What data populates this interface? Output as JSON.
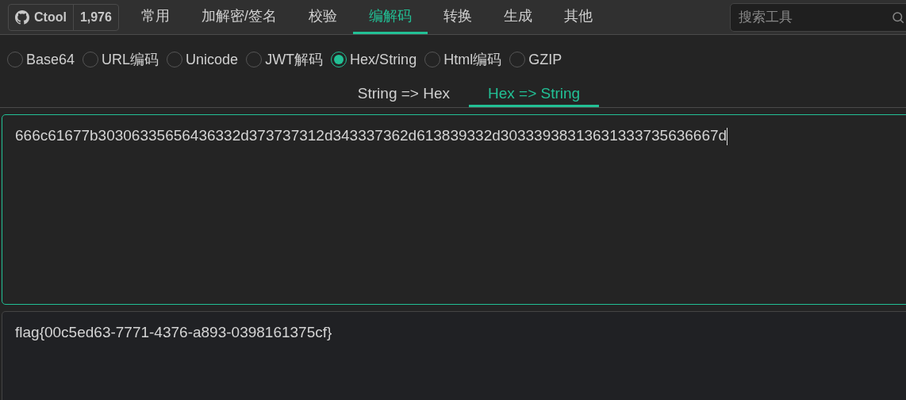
{
  "header": {
    "repo": {
      "name": "Ctool",
      "stars_count": "1,976"
    },
    "tabs": [
      {
        "label": "常用",
        "selected": false
      },
      {
        "label": "加解密/签名",
        "selected": false
      },
      {
        "label": "校验",
        "selected": false
      },
      {
        "label": "编解码",
        "selected": true
      },
      {
        "label": "转换",
        "selected": false
      },
      {
        "label": "生成",
        "selected": false
      },
      {
        "label": "其他",
        "selected": false
      }
    ],
    "search": {
      "placeholder": "搜索工具"
    }
  },
  "tools": [
    {
      "label": "Base64",
      "selected": false
    },
    {
      "label": "URL编码",
      "selected": false
    },
    {
      "label": "Unicode",
      "selected": false
    },
    {
      "label": "JWT解码",
      "selected": false
    },
    {
      "label": "Hex/String",
      "selected": true
    },
    {
      "label": "Html编码",
      "selected": false
    },
    {
      "label": "GZIP",
      "selected": false
    }
  ],
  "modes": [
    {
      "label": "String => Hex",
      "selected": false
    },
    {
      "label": "Hex => String",
      "selected": true
    }
  ],
  "input": {
    "value": "666c61677b30306335656436332d373737312d343337362d613839332d30333938313631333735636667d",
    "focused": true
  },
  "output": {
    "value": "flag{00c5ed63-7771-4376-a893-0398161375cf}"
  }
}
